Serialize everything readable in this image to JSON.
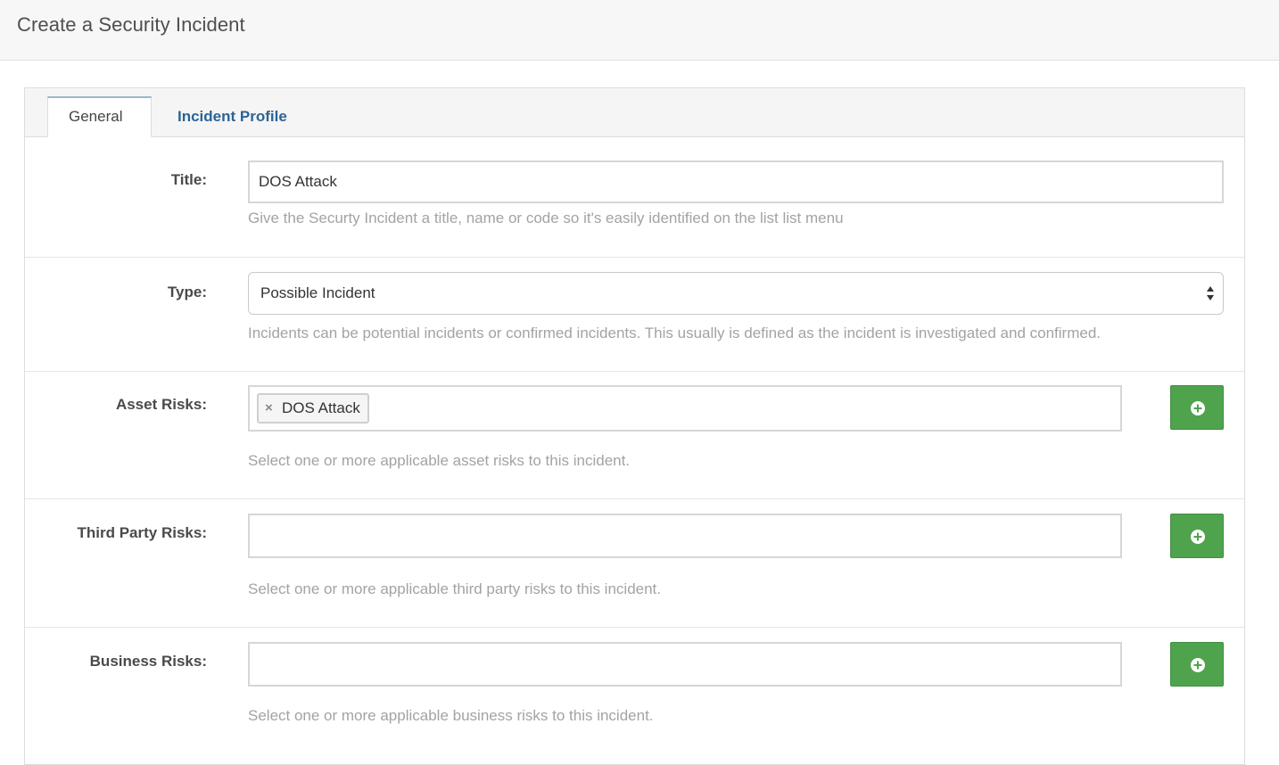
{
  "header": {
    "title": "Create a Security Incident"
  },
  "tabs": [
    {
      "label": "General",
      "active": true
    },
    {
      "label": "Incident Profile",
      "active": false
    }
  ],
  "form": {
    "title": {
      "label": "Title:",
      "value": "DOS Attack",
      "help": "Give the Securty Incident a title, name or code so it's easily identified on the list list menu"
    },
    "type": {
      "label": "Type:",
      "selected": "Possible Incident",
      "help": "Incidents can be potential incidents or confirmed incidents. This usually is defined as the incident is investigated and confirmed."
    },
    "asset_risks": {
      "label": "Asset Risks:",
      "tags": [
        "DOS Attack"
      ],
      "tag_remove": "×",
      "help": "Select one or more applicable asset risks to this incident."
    },
    "third_party_risks": {
      "label": "Third Party Risks:",
      "help": "Select one or more applicable third party risks to this incident."
    },
    "business_risks": {
      "label": "Business Risks:",
      "help": "Select one or more applicable business risks to this incident."
    }
  },
  "icons": {
    "add": "plus-circle-icon",
    "remove": "close-icon",
    "select": "sort-arrows-icon"
  },
  "colors": {
    "add_button": "#4fa34c",
    "tab_link": "#2a6496",
    "help_text": "#a3a3a3"
  }
}
